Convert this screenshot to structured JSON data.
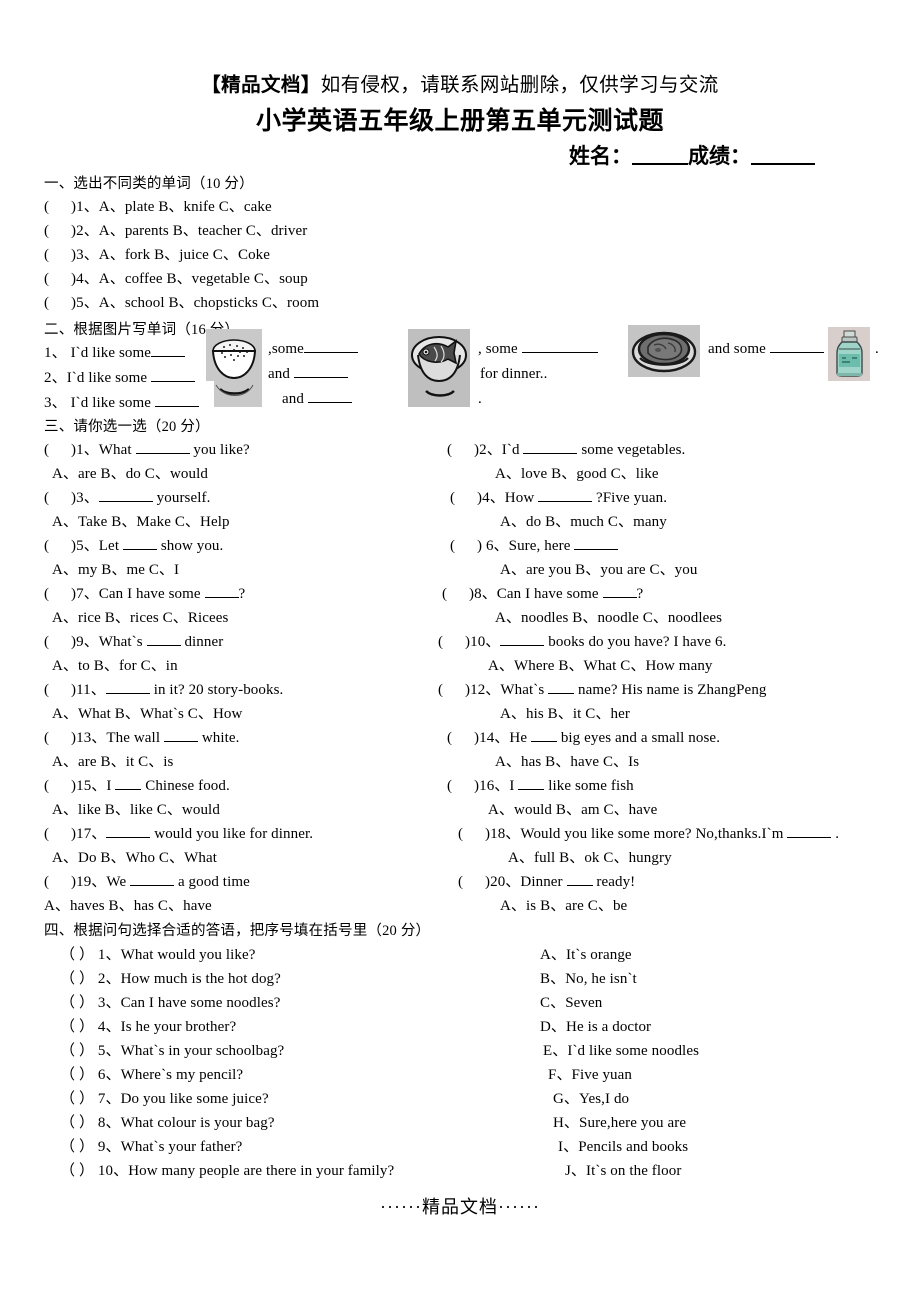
{
  "header": {
    "notice_bracket": "【精品文档】",
    "notice_text": "如有侵权，请联系网站删除，仅供学习与交流",
    "title": "小学英语五年级上册第五单元测试题",
    "name_label": "姓名：",
    "score_label": "成绩："
  },
  "section1": {
    "heading": "一、选出不同类的单词（10 分）",
    "items": [
      {
        "paren": "(",
        "close": ")",
        "num": "1、",
        "a": "A、plate",
        "b": "B、knife",
        "c": "C、cake"
      },
      {
        "paren": "(",
        "close": ")",
        "num": "2、",
        "a": "A、parents",
        "b": "B、teacher",
        "c": "C、driver"
      },
      {
        "paren": "(",
        "close": ")",
        "num": "3、",
        "a": "A、fork",
        "b": "B、juice",
        "c": "C、Coke"
      },
      {
        "paren": "(",
        "close": ")",
        "num": "4、",
        "a": "A、coffee",
        "b": "B、vegetable",
        "c": "C、soup"
      },
      {
        "paren": "(",
        "close": ")",
        "num": "5、",
        "a": "A、school",
        "b": "B、chopsticks",
        "c": "C、room"
      }
    ]
  },
  "section2": {
    "heading": "二、根据图片写单词（16 分）",
    "line1_num": "1、",
    "line1_a": "I`d like some",
    "line1_b": ",some",
    "line1_c": ", some",
    "line1_d": "and some",
    "line1_end": ".",
    "line2_num": "2、",
    "line2_a": "I`d like some",
    "line2_b": "and",
    "line2_c": "for   dinner..",
    "line3_num": "3、",
    "line3_a": "I`d like some",
    "line3_b": "and",
    "line3_end": ".",
    "images": [
      {
        "name": "rice-bowl-image",
        "alt": "bowl of rice"
      },
      {
        "name": "fish-plate-image",
        "alt": "fish on a plate"
      },
      {
        "name": "meat-plate-image",
        "alt": "meat on a plate"
      },
      {
        "name": "water-bottle-image",
        "alt": "water bottle"
      }
    ]
  },
  "section3": {
    "heading": "三、请你选一选（20 分）",
    "left": [
      {
        "q": ")1、What ___ you like?",
        "q_pre": ")1、What",
        "q_post": "you like?",
        "opts": "A、are    B、do    C、would"
      },
      {
        "q_pre": ")3、",
        "q_post": "yourself.",
        "opts": "A、Take    B、Make    C、Help"
      },
      {
        "q_pre": ")5、Let",
        "q_post": "show you.",
        "opts": "A、my    B、me   C、I"
      },
      {
        "q_pre": ")7、Can I have some",
        "q_post": "?",
        "opts": "A、rice    B、rices    C、Ricees"
      },
      {
        "q_pre": ")9、What`s",
        "q_post": "dinner",
        "opts": "A、to    B、for    C、in"
      },
      {
        "q_pre": ")11、",
        "q_post": "in it? 20 story-books.",
        "opts": "A、What    B、What`s    C、How"
      },
      {
        "q_pre": ")13、The wall",
        "q_post": "white.",
        "opts": "A、are    B、it    C、is"
      },
      {
        "q_pre": ")15、I",
        "q_post": "Chinese food.",
        "opts": "A、like     B、like   C、would"
      },
      {
        "q_pre": ")17、",
        "q_post": "would you like for dinner.",
        "opts": "A、Do    B、Who    C、What"
      },
      {
        "q_pre": ")19、We",
        "q_post": "a good time",
        "opts": "A、haves      B、has      C、have"
      }
    ],
    "right": [
      {
        "q_pre": ")2、I`d",
        "q_post": "some vegetables.",
        "opts": "A、love    B、good   C、like"
      },
      {
        "q_pre": ")4、How",
        "q_post": "?Five yuan.",
        "opts": "A、do      B、much     C、many"
      },
      {
        "q_pre": ") 6、Sure, here",
        "q_post": "",
        "opts": "A、are you    B、you are    C、you"
      },
      {
        "q_pre": ")8、Can I have some",
        "q_post": "?",
        "opts": "A、noodles    B、noodle    C、noodlees"
      },
      {
        "q_pre": ")10、",
        "q_post": "books do you have? I have 6.",
        "opts": "A、Where    B、What     C、How many"
      },
      {
        "q_pre": ")12、What`s",
        "q_post": "name? His name is ZhangPeng",
        "opts": "A、his    B、it    C、her"
      },
      {
        "q_pre": ")14、He",
        "q_post": "big eyes and a small nose.",
        "opts": "A、has     B、have     C、Is"
      },
      {
        "q_pre": ")16、I",
        "q_post": "like some fish",
        "opts": "A、would    B、am    C、have"
      },
      {
        "q_pre": ")18、Would you like some more? No,thanks.I`m",
        "q_post": ".",
        "opts": "A、full     B、ok      C、hungry"
      },
      {
        "q_pre": ")20、Dinner",
        "q_post": "ready!",
        "opts": "A、is      B、are    C、be"
      }
    ]
  },
  "section4": {
    "heading": "四、根据问句选择合适的答语，把序号填在括号里（20 分）",
    "questions": [
      "（    ）  1、What would you like?",
      "（    ） 2、How much is the hot dog?",
      "（    ） 3、Can I have some noodles?",
      "（    ） 4、Is he your brother?",
      "（    ） 5、What`s in your schoolbag?",
      "（    ） 6、Where`s my pencil?",
      "（    ） 7、Do you like some juice?",
      "（    ） 8、What colour is your bag?",
      "（    ） 9、What`s your father?",
      "（    ） 10、How many people are there in your family?"
    ],
    "answers": [
      "A、It`s orange",
      "B、No, he isn`t",
      "C、Seven",
      "D、He is a doctor",
      "E、I`d like some noodles",
      "F、Five yuan",
      "G、Yes,I do",
      "H、Sure,here you are",
      "I、Pencils and books",
      "J、It`s on the floor"
    ]
  },
  "footer": {
    "text": "······精品文档······"
  }
}
